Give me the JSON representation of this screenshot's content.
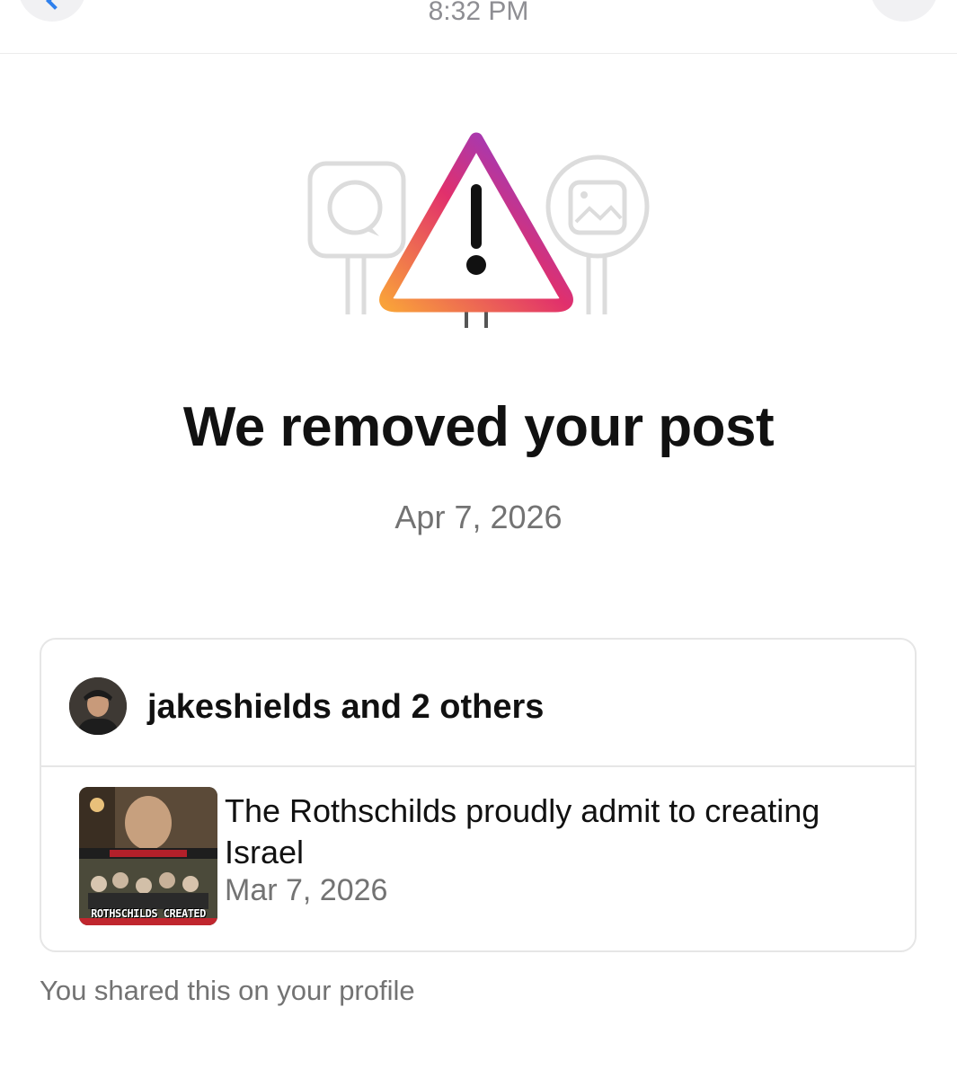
{
  "status_bar": {
    "time": "8:32 PM"
  },
  "notice": {
    "title": "We removed your post",
    "date": "Apr 7, 2026"
  },
  "card": {
    "users_label": "jakeshields and 2 others",
    "post": {
      "text": "The Rothschilds proudly admit to creating Israel",
      "date": "Mar 7, 2026",
      "thumbnail_caption": "ROTHSCHILDS CREATED"
    }
  },
  "footer": {
    "text": "You shared this on your profile"
  },
  "icons": {
    "back": "chevron-left-icon",
    "warning": "warning-triangle-icon",
    "comment": "comment-icon",
    "image": "image-icon"
  },
  "colors": {
    "link_blue": "#2f80ed",
    "gradient_start": "#f9a13a",
    "gradient_mid": "#e1306c",
    "gradient_end": "#7b3fe4",
    "muted_text": "#737373"
  }
}
